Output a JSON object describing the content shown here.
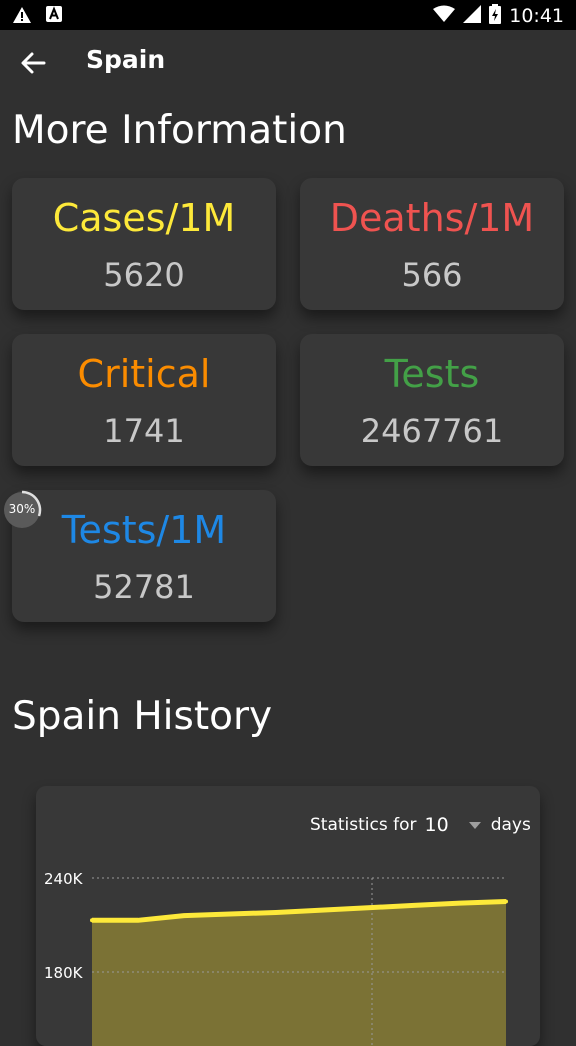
{
  "status_bar": {
    "time": "10:41",
    "icons": [
      "warning-icon",
      "font-icon",
      "wifi-icon",
      "signal-icon",
      "battery-icon"
    ]
  },
  "app_bar": {
    "title": "Spain",
    "back_icon": "arrow-back-icon"
  },
  "more_info": {
    "title": "More Information",
    "cards": [
      {
        "label": "Cases/1M",
        "value": "5620",
        "color": "#FDE93A"
      },
      {
        "label": "Deaths/1M",
        "value": "566",
        "color": "#EF5350"
      },
      {
        "label": "Critical",
        "value": "1741",
        "color": "#FB8C00"
      },
      {
        "label": "Tests",
        "value": "2467761",
        "color": "#43A047"
      },
      {
        "label": "Tests/1M",
        "value": "52781",
        "color": "#1E88E5"
      }
    ]
  },
  "progress_badge": {
    "text": "30%",
    "value": 0.3
  },
  "history": {
    "title": "Spain History",
    "stats_prefix": "Statistics for",
    "stats_days": "10",
    "stats_suffix": "days"
  },
  "chart_data": {
    "type": "area",
    "ytick_labels": [
      "240K",
      "180K"
    ],
    "ylim": [
      120000,
      250000
    ],
    "x": [
      1,
      2,
      3,
      4,
      5,
      6,
      7,
      8,
      9,
      10
    ],
    "series": [
      {
        "values": [
          213000,
          213000,
          216000,
          217000,
          218000,
          219500,
          221000,
          222500,
          224000,
          225000
        ],
        "color": "#FDE93A",
        "fill": "#7B7235"
      }
    ],
    "grid": true
  }
}
